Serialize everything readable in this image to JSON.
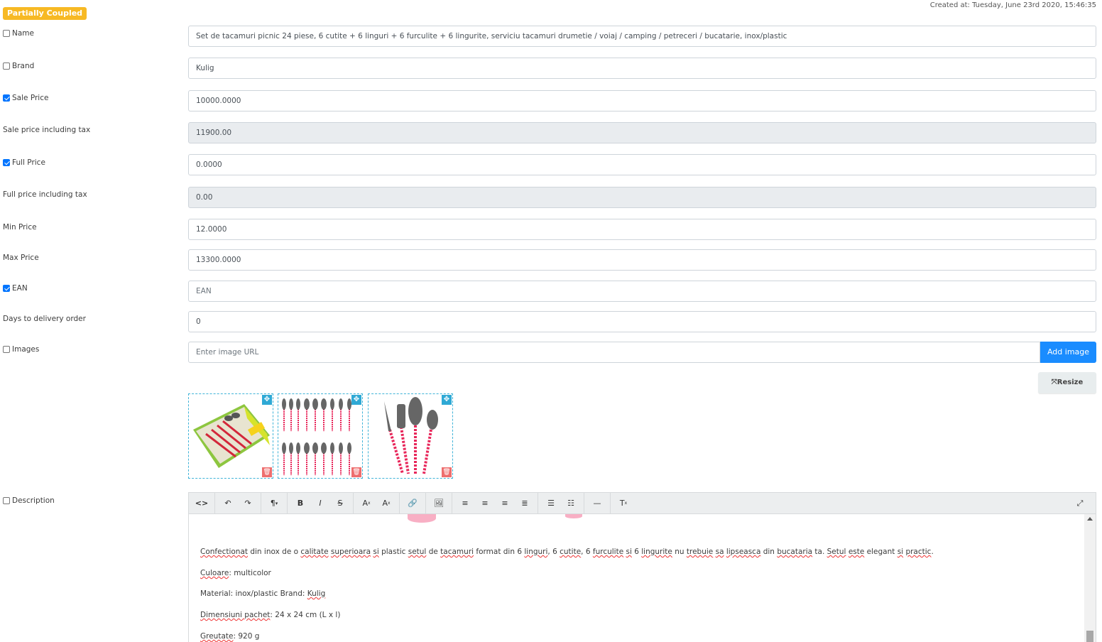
{
  "header": {
    "badge": "Partially Coupled",
    "created": "Created at: Tuesday, June 23rd 2020, 15:46:35",
    "badge_color": "#f7b924"
  },
  "fields": {
    "name": {
      "label": "Name",
      "checked": false,
      "value": "Set de tacamuri picnic 24 piese, 6 cutite + 6 linguri + 6 furculite + 6 lingurite, serviciu tacamuri drumetie / voiaj / camping / petreceri / bucatarie, inox/plastic"
    },
    "brand": {
      "label": "Brand",
      "checked": false,
      "value": "Kulig"
    },
    "sale_price": {
      "label": "Sale Price",
      "checked": true,
      "value": "10000.0000"
    },
    "sale_price_tax": {
      "label": "Sale price including tax",
      "value": "11900.00"
    },
    "full_price": {
      "label": "Full Price",
      "checked": true,
      "value": "0.0000"
    },
    "full_price_tax": {
      "label": "Full price including tax",
      "value": "0.00"
    },
    "min_price": {
      "label": "Min Price",
      "value": "12.0000"
    },
    "max_price": {
      "label": "Max Price",
      "value": "13300.0000"
    },
    "ean": {
      "label": "EAN",
      "checked": true,
      "placeholder": "EAN"
    },
    "days_delivery": {
      "label": "Days to delivery order",
      "value": "0"
    },
    "images": {
      "label": "Images",
      "checked": false,
      "placeholder": "Enter image URL",
      "add_button": "Add image",
      "resize_button": "Resize"
    },
    "description": {
      "label": "Description",
      "checked": false
    }
  },
  "toolbar": {
    "buttons": [
      "code-view",
      "undo",
      "redo",
      "paragraph",
      "bold",
      "italic",
      "strikethrough",
      "superscript",
      "subscript",
      "link",
      "image",
      "align-left",
      "align-center",
      "align-right",
      "align-justify",
      "unordered-list",
      "ordered-list",
      "horizontal-rule",
      "clear-format",
      "fullscreen"
    ]
  },
  "editor": {
    "line1_words": [
      "Confectionat",
      " din inox de o ",
      "calitate",
      " ",
      "superioara",
      " ",
      "si",
      " plastic ",
      "setul",
      " de ",
      "tacamuri",
      " format din 6 ",
      "linguri",
      ", 6 ",
      "cutite",
      ", 6 ",
      "furculite",
      " ",
      "si",
      " 6 ",
      "lingurite",
      " nu ",
      "trebuie",
      " ",
      "sa",
      " ",
      "lipseasca",
      " din ",
      "bucataria",
      " ta. ",
      "Setul",
      " ",
      "este",
      " elegant ",
      "si",
      " ",
      "practic",
      "."
    ],
    "line2_key": "Culoare",
    "line2_rest": ": multicolor",
    "line3_pre": "Material: inox/plastic Brand: ",
    "line3_brand": "Kulig",
    "line4_key": "Dimensiuni pachet",
    "line4_rest": ": 24 x 24 cm (L x l)",
    "line5_key": "Greutate",
    "line5_rest": ": 920 g"
  }
}
